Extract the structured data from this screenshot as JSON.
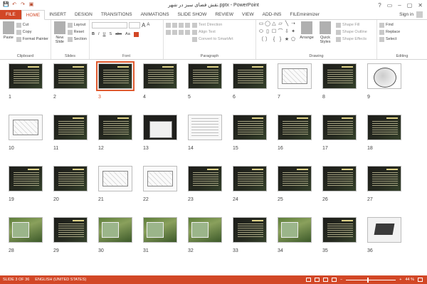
{
  "window": {
    "title": "نقش فضای سبز در شهر.pptx - PowerPoint",
    "buttons": [
      "?",
      "▭",
      "–",
      "▢",
      "✕"
    ]
  },
  "qat": [
    "💾",
    "↶",
    "↷",
    "▣"
  ],
  "tabs": [
    {
      "label": "FILE",
      "kind": "file"
    },
    {
      "label": "HOME",
      "kind": "active"
    },
    {
      "label": "INSERT",
      "kind": ""
    },
    {
      "label": "DESIGN",
      "kind": ""
    },
    {
      "label": "TRANSITIONS",
      "kind": ""
    },
    {
      "label": "ANIMATIONS",
      "kind": ""
    },
    {
      "label": "SLIDE SHOW",
      "kind": ""
    },
    {
      "label": "REVIEW",
      "kind": ""
    },
    {
      "label": "VIEW",
      "kind": ""
    },
    {
      "label": "ADD-INS",
      "kind": ""
    },
    {
      "label": "FILEminimizer",
      "kind": ""
    }
  ],
  "signin": "Sign in",
  "ribbon": {
    "clipboard": {
      "paste": "Paste",
      "cut": "Cut",
      "copy": "Copy",
      "format_painter": "Format Painter",
      "label": "Clipboard"
    },
    "slides": {
      "new_slide": "New Slide",
      "layout": "Layout",
      "reset": "Reset",
      "section": "Section",
      "label": "Slides"
    },
    "font": {
      "label": "Font",
      "bold": "B",
      "italic": "I",
      "underline": "U",
      "strike": "S",
      "abc": "abc",
      "aa": "Aa",
      "grow": "A",
      "shrink": "A"
    },
    "paragraph": {
      "text_direction": "Text Direction",
      "align_text": "Align Text",
      "convert_smartart": "Convert to SmartArt",
      "label": "Paragraph"
    },
    "drawing": {
      "arrange": "Arrange",
      "quick_styles": "Quick Styles",
      "shape_fill": "Shape Fill",
      "shape_outline": "Shape Outline",
      "shape_effects": "Shape Effects",
      "label": "Drawing",
      "shapes": [
        "▭",
        "◯",
        "△",
        "▱",
        "╲",
        "➝",
        "⬭",
        "▯",
        "☐",
        "⌒",
        "⇩",
        "✦",
        "〔",
        "〕",
        "{",
        "}",
        "★",
        "⬠"
      ]
    },
    "editing": {
      "find": "Find",
      "replace": "Replace",
      "select": "Select",
      "label": "Editing"
    }
  },
  "slides": [
    {
      "n": "1",
      "style": "dark"
    },
    {
      "n": "2",
      "style": "dark"
    },
    {
      "n": "3",
      "style": "dark",
      "selected": true
    },
    {
      "n": "4",
      "style": "dark"
    },
    {
      "n": "5",
      "style": "dark"
    },
    {
      "n": "6",
      "style": "dark"
    },
    {
      "n": "7",
      "style": "white"
    },
    {
      "n": "8",
      "style": "dark"
    },
    {
      "n": "9",
      "style": "sketch"
    },
    {
      "n": "10",
      "style": "white"
    },
    {
      "n": "11",
      "style": "dark"
    },
    {
      "n": "12",
      "style": "dark"
    },
    {
      "n": "13",
      "style": "mixed"
    },
    {
      "n": "14",
      "style": "table"
    },
    {
      "n": "15",
      "style": "dark"
    },
    {
      "n": "16",
      "style": "dark"
    },
    {
      "n": "17",
      "style": "dark"
    },
    {
      "n": "18",
      "style": "dark"
    },
    {
      "n": "19",
      "style": "dark"
    },
    {
      "n": "20",
      "style": "dark"
    },
    {
      "n": "21",
      "style": "white"
    },
    {
      "n": "22",
      "style": "white"
    },
    {
      "n": "23",
      "style": "dark"
    },
    {
      "n": "24",
      "style": "dark"
    },
    {
      "n": "25",
      "style": "dark"
    },
    {
      "n": "26",
      "style": "dark"
    },
    {
      "n": "27",
      "style": "dark"
    },
    {
      "n": "28",
      "style": "photo"
    },
    {
      "n": "29",
      "style": "dark"
    },
    {
      "n": "30",
      "style": "photo"
    },
    {
      "n": "31",
      "style": "photo"
    },
    {
      "n": "32",
      "style": "photo"
    },
    {
      "n": "33",
      "style": "dark"
    },
    {
      "n": "34",
      "style": "photo"
    },
    {
      "n": "35",
      "style": "dark"
    },
    {
      "n": "36",
      "style": "laptop"
    }
  ],
  "status": {
    "slide_info": "SLIDE 3 OF 36",
    "language": "ENGLISH (UNITED STATES)",
    "zoom": "44 %"
  },
  "colors": {
    "accent": "#d24726",
    "selection": "#e05a2f"
  }
}
